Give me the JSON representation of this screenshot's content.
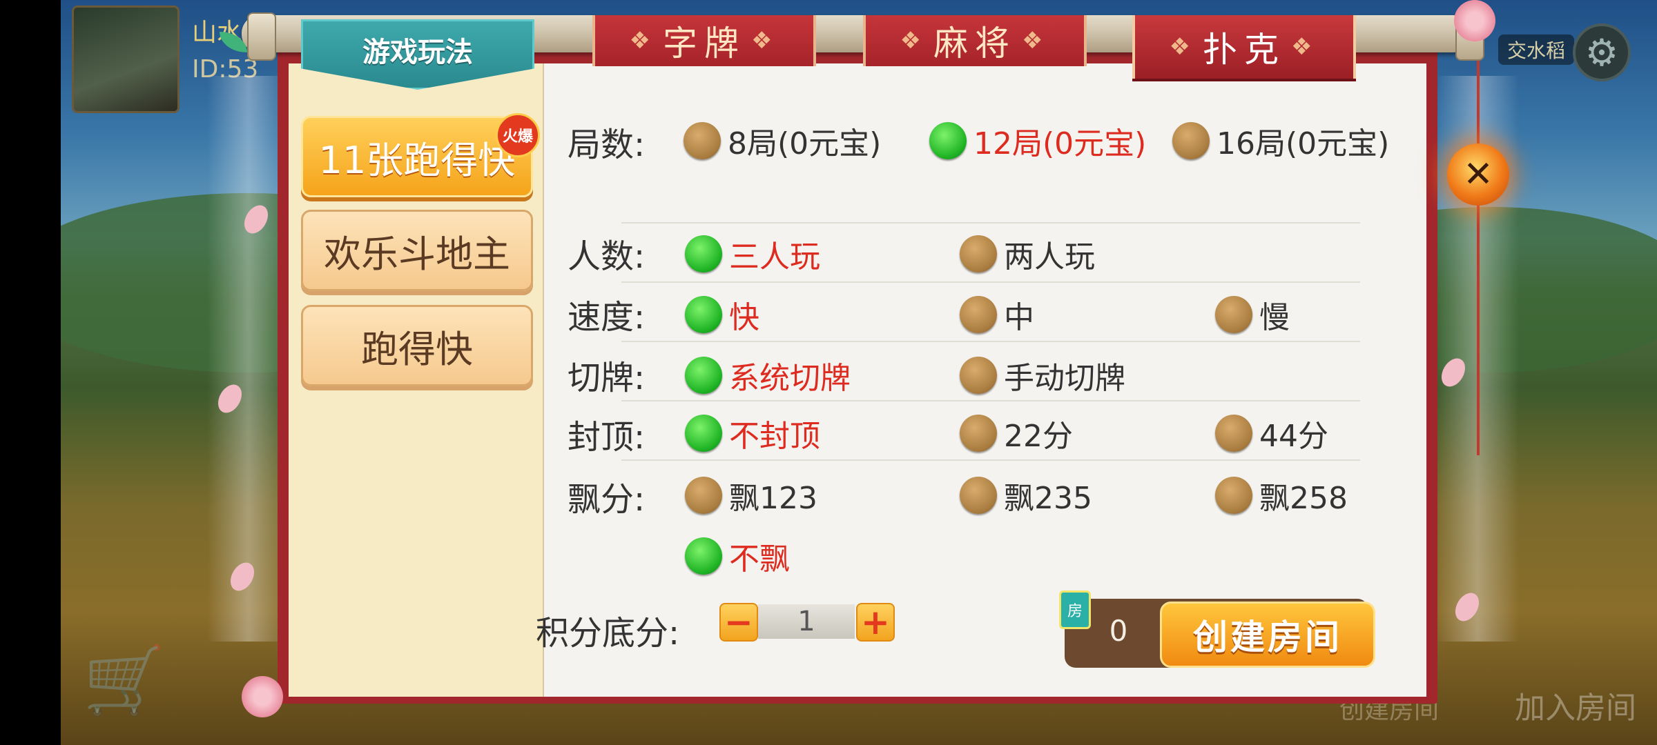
{
  "profile": {
    "name": "山水",
    "id_label": "ID:53"
  },
  "province_label": "交水稻",
  "tabs": [
    {
      "label": "游戏玩法"
    },
    {
      "label": "字牌"
    },
    {
      "label": "麻将"
    },
    {
      "label": "扑克"
    }
  ],
  "games": [
    {
      "label": "11张跑得快",
      "badge": "火爆",
      "active": true
    },
    {
      "label": "欢乐斗地主"
    },
    {
      "label": "跑得快"
    }
  ],
  "rules": {
    "rounds": {
      "label": "局数:",
      "options": [
        "8局(0元宝)",
        "12局(0元宝)",
        "16局(0元宝)"
      ],
      "selected": 1
    },
    "players": {
      "label": "人数:",
      "options": [
        "三人玩",
        "两人玩"
      ],
      "selected": 0
    },
    "speed": {
      "label": "速度:",
      "options": [
        "快",
        "中",
        "慢"
      ],
      "selected": 0
    },
    "cut": {
      "label": "切牌:",
      "options": [
        "系统切牌",
        "手动切牌"
      ],
      "selected": 0
    },
    "cap": {
      "label": "封顶:",
      "options": [
        "不封顶",
        "22分",
        "44分"
      ],
      "selected": 0
    },
    "float": {
      "label": "飘分:",
      "options": [
        "飘123",
        "飘235",
        "飘258",
        "不飘"
      ],
      "selected": 3
    }
  },
  "base_score": {
    "label": "积分底分:",
    "value": "1",
    "minus": "−",
    "plus": "+"
  },
  "room_card": {
    "icon_text": "房",
    "count": "0"
  },
  "create_button": "创建房间",
  "bottom": {
    "create_room": "创建房间",
    "join_room": "加入房间"
  },
  "colors": {
    "selected": "#dd2b20",
    "panel_border": "#a2272c",
    "tab_active": "#2a8a8f"
  }
}
